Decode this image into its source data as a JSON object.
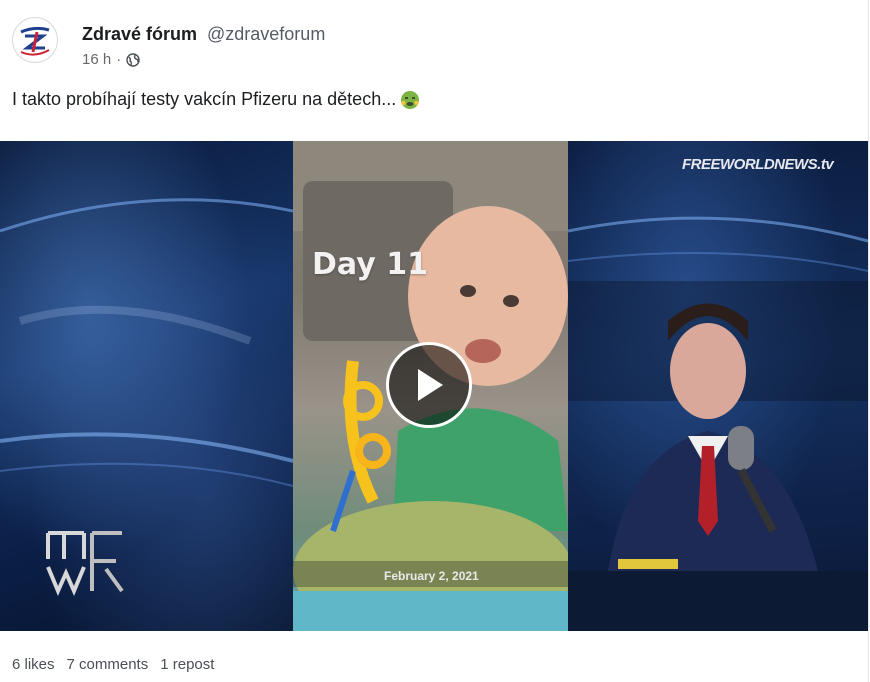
{
  "post": {
    "author_name": "Zdravé fórum",
    "author_handle": "@zdraveforum",
    "timestamp": "16 h",
    "separator": "·",
    "visibility_icon": "globe-icon",
    "text": "I takto probíhají testy vakcín Pfizeru na dětech...",
    "emoji": "nauseated-face-emoji"
  },
  "video": {
    "overlay_day": "Day 11",
    "overlay_date": "February 2, 2021",
    "channel_logo": "FREEWORLDNEWS.tv",
    "corner_logo": "INFOWARS",
    "play_icon": "play-icon"
  },
  "stats": {
    "likes": "6 likes",
    "comments": "7 comments",
    "reposts": "1 repost"
  }
}
